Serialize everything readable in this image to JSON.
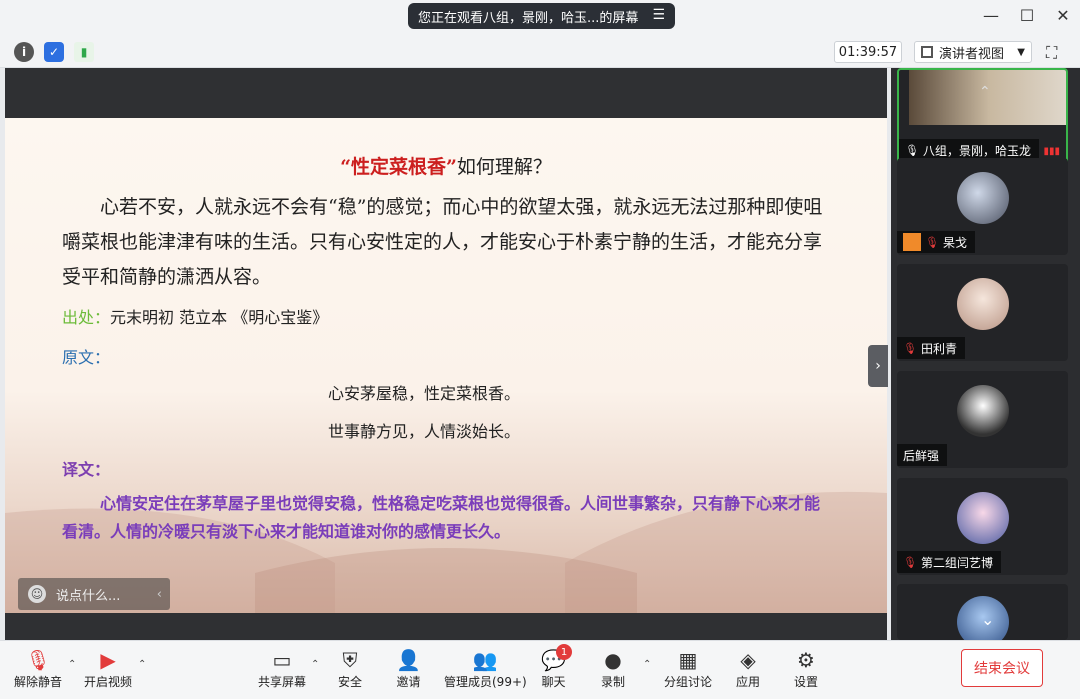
{
  "window": {
    "share_banner": "您正在观看八组，景刚，哈玉...的屏幕",
    "minimize": "—",
    "maximize": "☐",
    "close": "✕"
  },
  "infobar": {
    "timer": "01:39:57",
    "view_label": "演讲者视图"
  },
  "slide": {
    "title_highlight": "“性定菜根香”",
    "title_rest": "如何理解？",
    "paragraph": "心若不安，人就永远不会有“稳”的感觉；而心中的欲望太强，就永远无法过那种即使咀嚼菜根也能津津有味的生活。只有心安性定的人，才能安心于朴素宁静的生活，才能充分享受平和简静的潇洒从容。",
    "source_label": "出处：",
    "source_text": "元末明初 范立本 《明心宝鉴》",
    "original_label": "原文：",
    "poem_line1": "心安茅屋稳，性定菜根香。",
    "poem_line2": "世事静方见，人情淡始长。",
    "translation_label": "译文：",
    "translation_text": "心情安定住在茅草屋子里也觉得安稳，性格稳定吃菜根也觉得很香。人间世事繁杂，只有静下心来才能看清。人情的冷暖只有淡下心来才能知道谁对你的感情更长久。"
  },
  "chat": {
    "placeholder": "说点什么..."
  },
  "participants": [
    {
      "name": "八组，景刚，哈玉龙",
      "muted": false
    },
    {
      "name": "杲戈",
      "muted": true
    },
    {
      "name": "田利青",
      "muted": true
    },
    {
      "name": "后鲜强",
      "muted": false
    },
    {
      "name": "第二组闫艺博",
      "muted": true
    },
    {
      "name": "",
      "muted": false
    }
  ],
  "toolbar": {
    "mute": "解除静音",
    "video": "开启视频",
    "share": "共享屏幕",
    "security": "安全",
    "invite": "邀请",
    "manage": "管理成员(99+)",
    "chat": "聊天",
    "chat_badge": "1",
    "record": "录制",
    "breakout": "分组讨论",
    "apps": "应用",
    "settings": "设置",
    "end": "结束会议"
  },
  "colors": {
    "accent_red": "#e23b3b",
    "active_green": "#39b54a",
    "title_red": "#cc1f1f",
    "translation_purple": "#7a3dba"
  }
}
